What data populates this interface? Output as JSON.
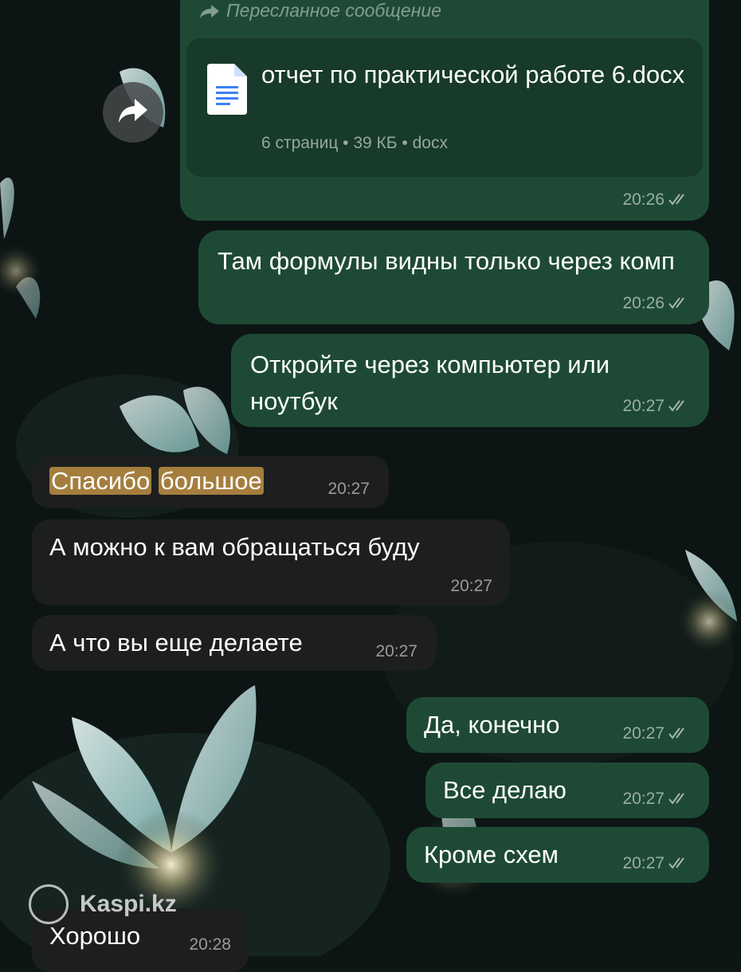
{
  "colors": {
    "outgoing_bubble": "#1e4a35",
    "incoming_bubble": "#1c1e1f",
    "file_card": "#173a2a",
    "highlight": "#a57e3e",
    "doc_icon_accent": "#3b82f6"
  },
  "forwarded": {
    "header": "Пересланное сообщение",
    "file_name": "отчет по практической работе 6.docx",
    "file_meta": "6 страниц • 39 КБ • docx",
    "time": "20:26",
    "status": "read"
  },
  "messages": [
    {
      "id": "m2",
      "direction": "out",
      "text": "Там формулы видны только через комп",
      "time": "20:26",
      "status": "read"
    },
    {
      "id": "m3",
      "direction": "out",
      "text": "Откройте через компьютер или ноутбук",
      "time": "20:27",
      "status": "read"
    },
    {
      "id": "m4",
      "direction": "in",
      "text_parts": [
        "Спасибо",
        "большое"
      ],
      "highlighted": true,
      "time": "20:27"
    },
    {
      "id": "m5",
      "direction": "in",
      "text": "А можно к вам обращаться буду",
      "time": "20:27"
    },
    {
      "id": "m6",
      "direction": "in",
      "text": "А что вы еще делаете",
      "time": "20:27"
    },
    {
      "id": "m7",
      "direction": "out",
      "text": "Да, конечно",
      "time": "20:27",
      "status": "read"
    },
    {
      "id": "m8",
      "direction": "out",
      "text": "Все делаю",
      "time": "20:27",
      "status": "read"
    },
    {
      "id": "m9",
      "direction": "out",
      "text": "Кроме схем",
      "time": "20:27",
      "status": "read"
    },
    {
      "id": "m10",
      "direction": "in",
      "text": "Хорошо",
      "time": "20:28"
    }
  ],
  "icons": {
    "forward_button": "share-arrow-icon",
    "forward_header": "forward-arrow-icon",
    "file": "document-icon",
    "read_status": "double-check-icon"
  },
  "watermark": {
    "text": "Kaspi.kz"
  }
}
